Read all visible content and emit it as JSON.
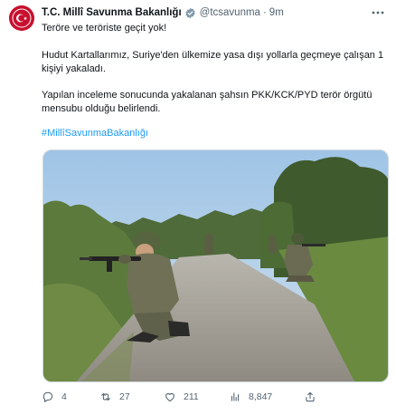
{
  "tweet": {
    "author": {
      "display_name": "T.C. Millî Savunma Bakanlığı",
      "handle": "@tcsavunma",
      "separator": "·",
      "time": "9m",
      "verified": true
    },
    "text": {
      "line1": "Teröre ve teröriste geçit yok!",
      "para2": "Hudut Kartallarımız, Suriye'den ülkemize yasa dışı yollarla geçmeye çalışan 1 kişiyi yakaladı.",
      "para3": "Yapılan inceleme sonucunda yakalanan şahsın PKK/KCK/PYD terör örgütü mensubu olduğu belirlendi.",
      "hashtag": "#MillîSavunmaBakanlığı"
    },
    "metrics": {
      "replies": "4",
      "retweets": "27",
      "likes": "211",
      "views": "8,847"
    }
  },
  "colors": {
    "accent": "#1d9bf0",
    "secondary_text": "#536471",
    "avatar_red": "#c8102e"
  }
}
